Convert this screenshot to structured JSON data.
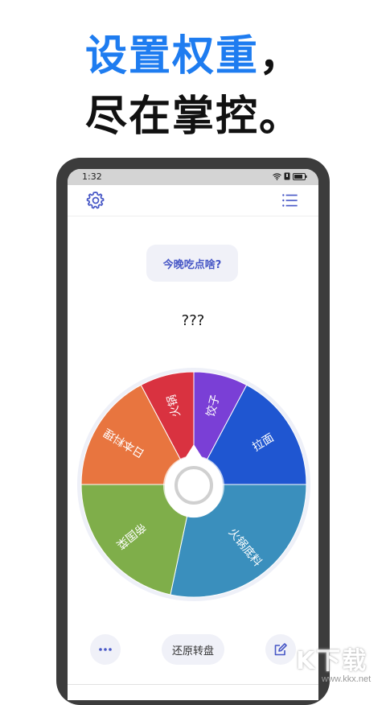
{
  "headline": {
    "line1_highlight": "设置权重",
    "line1_punct": "，",
    "line2": "尽在掌控。"
  },
  "status_bar": {
    "time": "1:32"
  },
  "app_bar": {
    "settings_icon": "gear-icon",
    "list_icon": "list-icon"
  },
  "question": "今晚吃点啥?",
  "result": "???",
  "wheel": {
    "segments": [
      {
        "label": "饺子",
        "color": "#7a3fd6"
      },
      {
        "label": "拉面",
        "color": "#1f56d1"
      },
      {
        "label": "火锅底料",
        "color": "#3a8fbd"
      },
      {
        "label": "帝国菜",
        "color": "#7fae4a"
      },
      {
        "label": "日本料理",
        "color": "#e8753f"
      },
      {
        "label": "火锅",
        "color": "#d93240"
      }
    ]
  },
  "bottom": {
    "more_icon": "more-icon",
    "reset_label": "还原转盘",
    "edit_icon": "edit-icon"
  },
  "watermark": {
    "main": "K下载",
    "sub": "www.kkx.net"
  },
  "colors": {
    "accent": "#1e7cf0",
    "button_bg": "#f0f1f8",
    "button_text": "#4757c6"
  }
}
